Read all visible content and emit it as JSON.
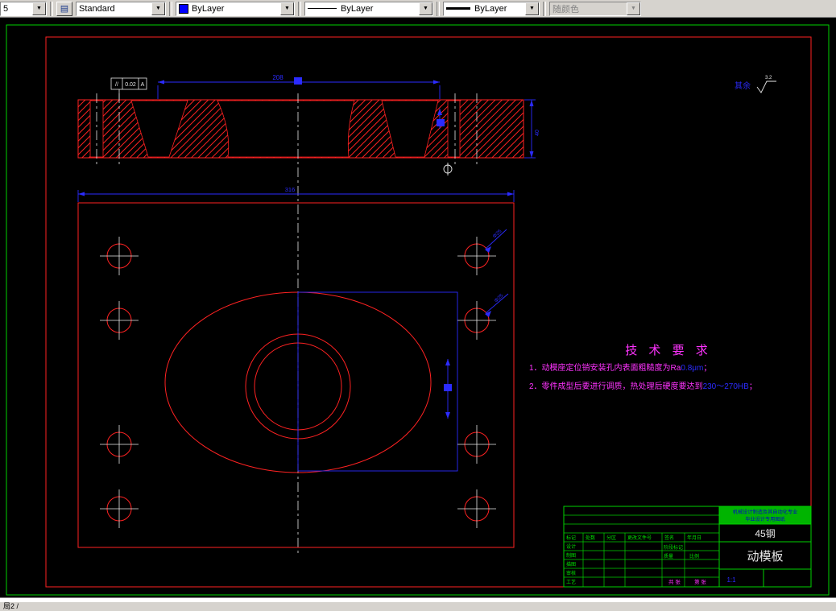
{
  "toolbar": {
    "layer_value": "5",
    "style_value": "Standard",
    "color_value": "ByLayer",
    "linetype_value": "ByLayer",
    "lineweight_value": "ByLayer",
    "plotstyle_value": "随颜色"
  },
  "drawing": {
    "dim_width_top": "208",
    "dim_width_overall": "316",
    "dim_height_section": "40",
    "datum_symbol": "//",
    "datum_tolerance": "0.02",
    "datum_ref": "A",
    "hole_label": "Φ25",
    "surface_label": "其余",
    "surface_value": "3.2",
    "tech_title": "技 术 要 求",
    "tech_line1_a": "1．动模座定位销安装孔内表面粗糙度为Ra",
    "tech_line1_b": "0.8μm",
    "tech_line1_c": "；",
    "tech_line2_a": "2．零件成型后要进行调质，热处理后硬度要达到",
    "tech_line2_b": "230～270HB",
    "tech_line2_c": "；"
  },
  "titleblock": {
    "school_line1": "机械设计制造及其自动化专业",
    "school_line2": "毕业设计专用图纸",
    "material": "45钢",
    "part_name": "动模板",
    "scale_value": "1:1",
    "labels": {
      "mark": "标记",
      "count": "处数",
      "zone": "分区",
      "change_doc": "更改文件号",
      "sign": "签名",
      "date": "年月日",
      "design": "设计",
      "draft": "制图",
      "trace": "描图",
      "check": "审核",
      "process": "工艺",
      "stage": "阶段标记",
      "weight": "质量",
      "scale": "比例",
      "sheets": "共 张",
      "sheet_no": "第 张"
    }
  },
  "statusbar": {
    "left_text": "局2 /"
  }
}
